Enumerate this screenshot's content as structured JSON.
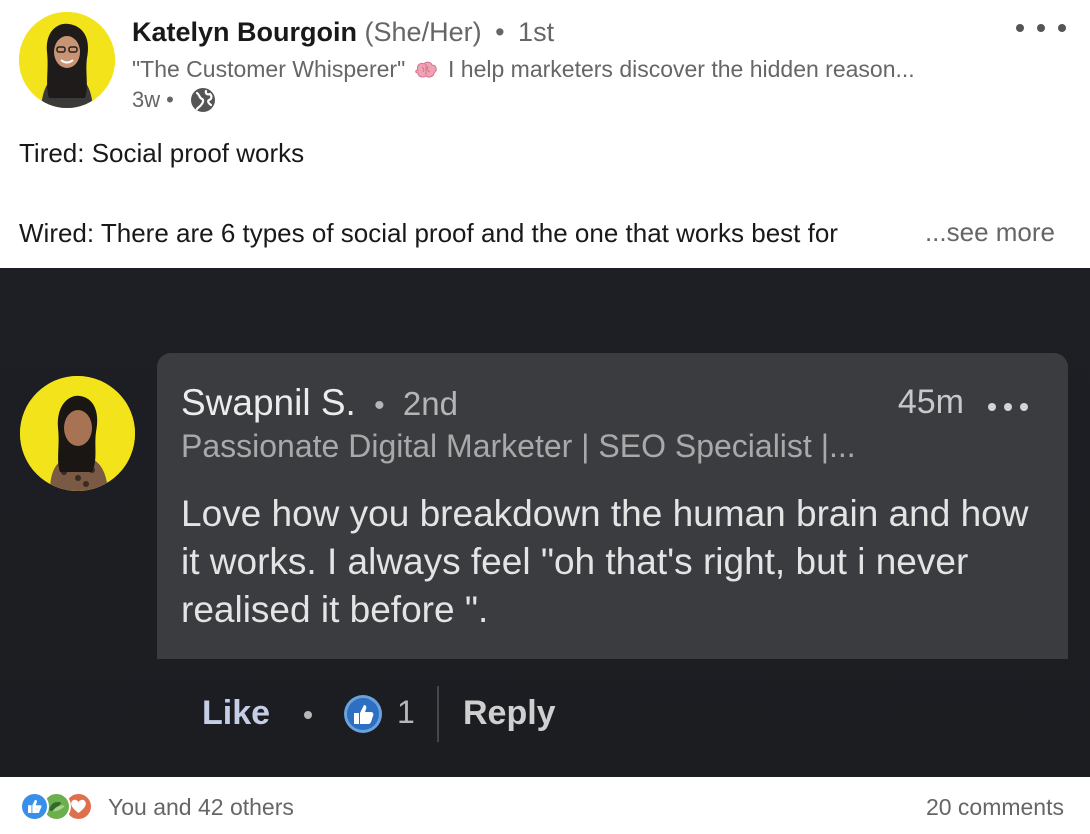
{
  "post": {
    "author": {
      "name": "Katelyn Bourgoin",
      "pronouns": "(She/Her)",
      "degree": "1st",
      "headline_quote": "\"The Customer Whisperer\"",
      "headline_rest": "I help marketers discover the hidden reason...",
      "age": "3w"
    },
    "text_line_1": "Tired: Social proof works",
    "text_line_2": "Wired: There are 6 types of social proof and the one that works best for",
    "see_more": "...see more"
  },
  "image_comment": {
    "name": "Swapnil S.",
    "degree": "2nd",
    "time": "45m",
    "headline": "Passionate Digital Marketer | SEO Specialist |...",
    "body": "Love how you breakdown the human brain and how it works. I always feel \"oh that's right, but i never realised it before \".",
    "like_label": "Like",
    "reaction_count": "1",
    "reply_label": "Reply"
  },
  "footer": {
    "reactions_text": "You and 42 others",
    "comments_text": "20 comments"
  },
  "colors": {
    "linkedin_like_blue": "#378fe9",
    "support_green": "#6dae4f",
    "love_red": "#df704d",
    "avatar_yellow": "#f2e31b"
  },
  "icons": [
    "brain-emoji-icon",
    "globe-icon",
    "more-options-icon",
    "thumbs-up-icon",
    "like-reaction-icon",
    "support-reaction-icon",
    "love-reaction-icon"
  ]
}
